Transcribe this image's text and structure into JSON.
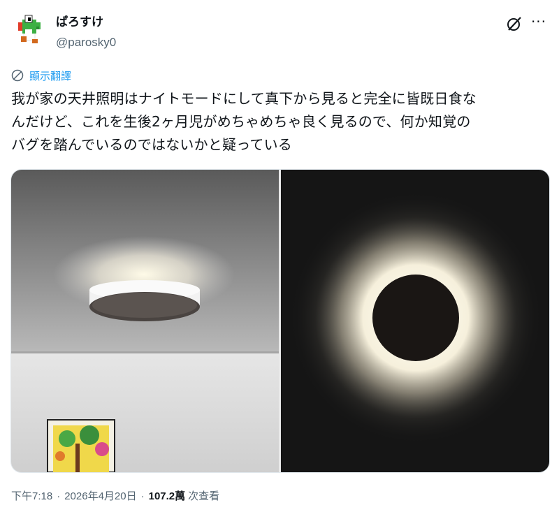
{
  "author": {
    "display_name": "ぱろすけ",
    "handle": "@parosky0",
    "avatar_icon": "pixel-yoshi-avatar"
  },
  "actions": {
    "grok_icon": "grok-icon",
    "more_icon": "more-icon",
    "more_glyph": "···"
  },
  "translate": {
    "label": "顯示翻譯",
    "icon": "globe-translate-icon"
  },
  "tweet": {
    "lines": [
      "我が家の天井照明はナイトモードにして真下から見ると完全に皆既日食な",
      "んだけど、これを生後2ヶ月児がめちゃめちゃ良く見るので、何か知覚の",
      "バグを踏んでいるのではないかと疑っている"
    ]
  },
  "media": {
    "photos": [
      "ceiling-light-side-photo",
      "ceiling-light-eclipse-photo"
    ]
  },
  "meta": {
    "time": "下午7:18",
    "separator": "·",
    "date": "2026年4月20日",
    "views_count": "107.2萬",
    "views_label": "次查看"
  },
  "colors": {
    "accent": "#1d9bf0",
    "text": "#0f1419",
    "secondary": "#536471"
  }
}
